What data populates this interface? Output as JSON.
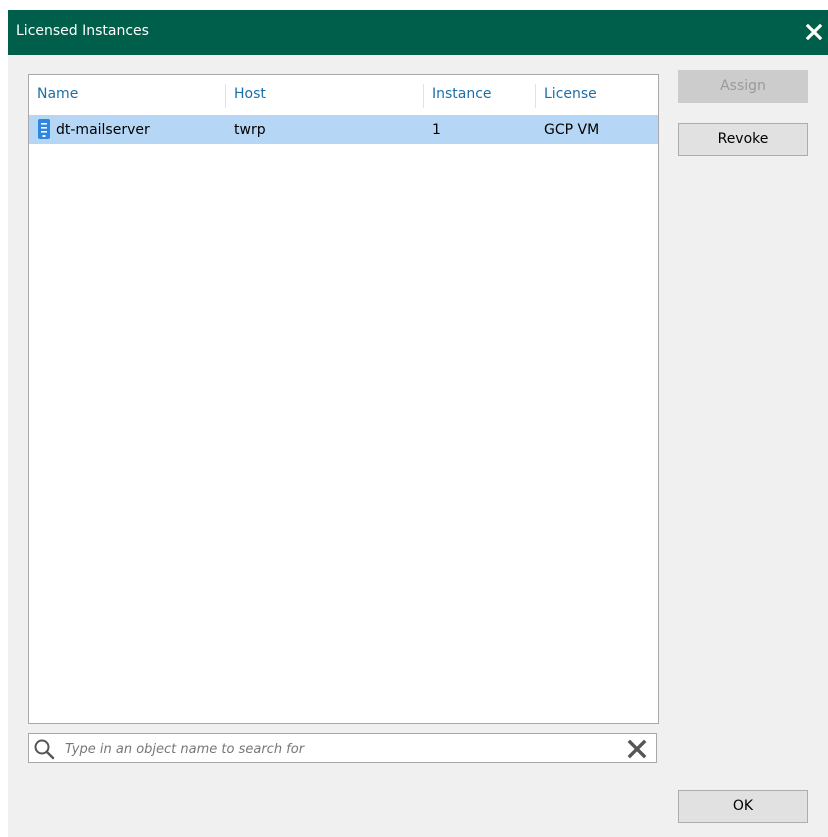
{
  "window": {
    "title": "Licensed Instances"
  },
  "table": {
    "columns": [
      "Name",
      "Host",
      "Instance",
      "License"
    ],
    "rows": [
      {
        "name": "dt-mailserver",
        "host": "twrp",
        "instance": "1",
        "license": "GCP VM",
        "icon": "server-icon",
        "selected": true
      }
    ]
  },
  "search": {
    "placeholder": "Type in an object name to search for",
    "value": ""
  },
  "buttons": {
    "assign": "Assign",
    "revoke": "Revoke",
    "ok": "OK"
  },
  "colors": {
    "titlebar": "#005f4b",
    "header_text": "#1c6fa6",
    "selected_row": "#b5d7f5",
    "icon": "#2e86de"
  }
}
